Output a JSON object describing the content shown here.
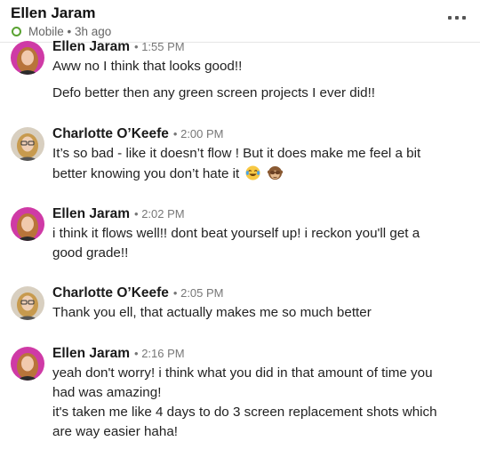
{
  "header": {
    "name": "Ellen Jaram",
    "status": "Mobile • 3h ago"
  },
  "messages": [
    {
      "sender": "Ellen Jaram",
      "time": "• 1:55 PM",
      "lines": [
        "Aww no I think that looks good!!",
        "Defo better then any green screen projects I ever did!!"
      ]
    },
    {
      "sender": "Charlotte O’Keefe",
      "time": "• 2:00 PM",
      "lines": [
        "It’s so bad - like it doesn’t flow ! But it does make me feel a bit",
        "better knowing you don’t hate it"
      ],
      "emojis": [
        "joy-emoji",
        "see-no-evil-monkey-emoji"
      ]
    },
    {
      "sender": "Ellen Jaram",
      "time": "• 2:02 PM",
      "lines": [
        "i think it flows well!! dont beat yourself up! i reckon you'll get a",
        "good grade!!"
      ]
    },
    {
      "sender": "Charlotte O’Keefe",
      "time": "• 2:05 PM",
      "lines": [
        "Thank you ell, that actually makes me so much better"
      ]
    },
    {
      "sender": "Ellen Jaram",
      "time": "• 2:16 PM",
      "lines": [
        "yeah don't worry! i think what you did in that amount of time you",
        "had was amazing!",
        "it's taken me like 4 days to do 3 screen replacement shots which",
        "are way easier haha!"
      ]
    }
  ],
  "colors": {
    "online": "#5aa332",
    "ellen_avatar_bg": "#cf3aa6",
    "charlotte_avatar_bg": "#d8cfc0"
  }
}
